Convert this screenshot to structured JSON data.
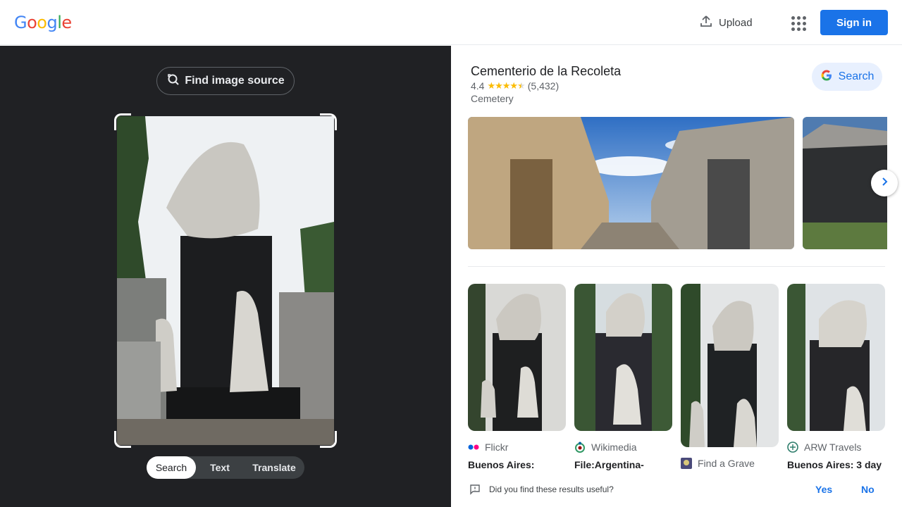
{
  "header": {
    "logo": [
      "G",
      "o",
      "o",
      "g",
      "l",
      "e"
    ],
    "logo_colors": [
      "#4285f4",
      "#ea4335",
      "#fbbc05",
      "#4285f4",
      "#34a853",
      "#ea4335"
    ],
    "upload_label": "Upload",
    "apps_icon": "apps-grid-icon",
    "signin_label": "Sign in"
  },
  "left": {
    "find_source_label": "Find image source",
    "find_source_icon": "lens-search-icon",
    "modes": [
      "Search",
      "Text",
      "Translate"
    ],
    "active_mode": "Search"
  },
  "place": {
    "title": "Cementerio de la Recoleta",
    "rating": "4.4",
    "stars": 4.5,
    "review_count": "(5,432)",
    "type": "Cemetery",
    "search_label": "Search"
  },
  "results": [
    {
      "source": "Flickr",
      "title": "Buenos Aires:",
      "icon": "flickr-icon"
    },
    {
      "source": "Wikimedia",
      "title": "File:Argentina-",
      "icon": "wikimedia-icon"
    },
    {
      "source": "Find a Grave",
      "title": "",
      "icon": "findagrave-icon"
    },
    {
      "source": "ARW Travels",
      "title": "Buenos Aires: 3 day",
      "icon": "arw-travels-icon"
    }
  ],
  "feedback": {
    "question": "Did you find these results useful?",
    "yes": "Yes",
    "no": "No"
  },
  "colors": {
    "accent": "#1a73e8",
    "dark_panel": "#202124",
    "star": "#fbbc04"
  }
}
